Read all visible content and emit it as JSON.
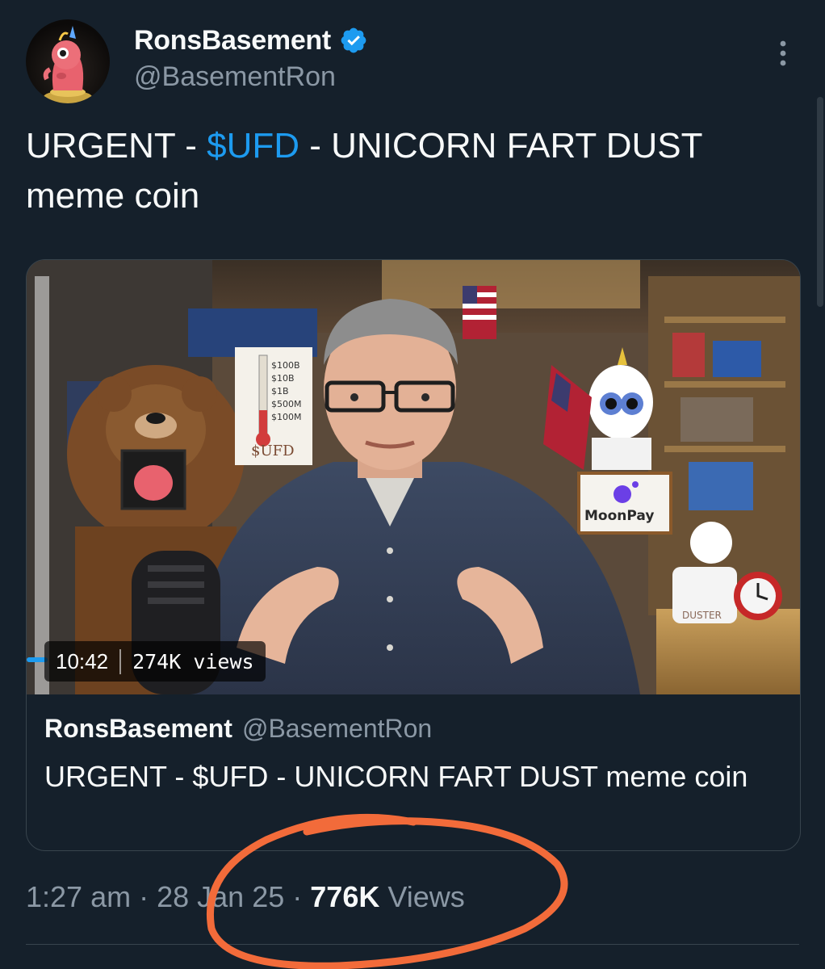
{
  "post": {
    "author": {
      "display_name": "RonsBasement",
      "handle": "@BasementRon",
      "verified": true
    },
    "text": {
      "before_cashtag": "URGENT - ",
      "cashtag": "$UFD",
      "after_cashtag": " - UNICORN FART DUST meme coin"
    },
    "card": {
      "video": {
        "duration": "10:42",
        "views": "274K views",
        "scene_signs": {
          "thermometer_values": [
            "$100B",
            "$10B",
            "$1B",
            "$500M",
            "$100M"
          ],
          "thermometer_label": "$UFD",
          "sponsor_box": "MoonPay",
          "jar_label": "DUSTER"
        }
      },
      "author_name": "RonsBasement",
      "author_handle": "@BasementRon",
      "title": "URGENT - $UFD - UNICORN FART DUST meme coin"
    },
    "meta": {
      "time": "1:27 am",
      "separator": "·",
      "date": "28 Jan 25",
      "views_count": "776K",
      "views_label": "Views"
    }
  },
  "icons": {
    "more": "more-vertical-icon",
    "verified": "verified-badge-icon"
  },
  "colors": {
    "background": "#15202b",
    "accent": "#1d9bf0",
    "secondary_text": "#8b98a5",
    "annotation": "#f26b3a"
  }
}
